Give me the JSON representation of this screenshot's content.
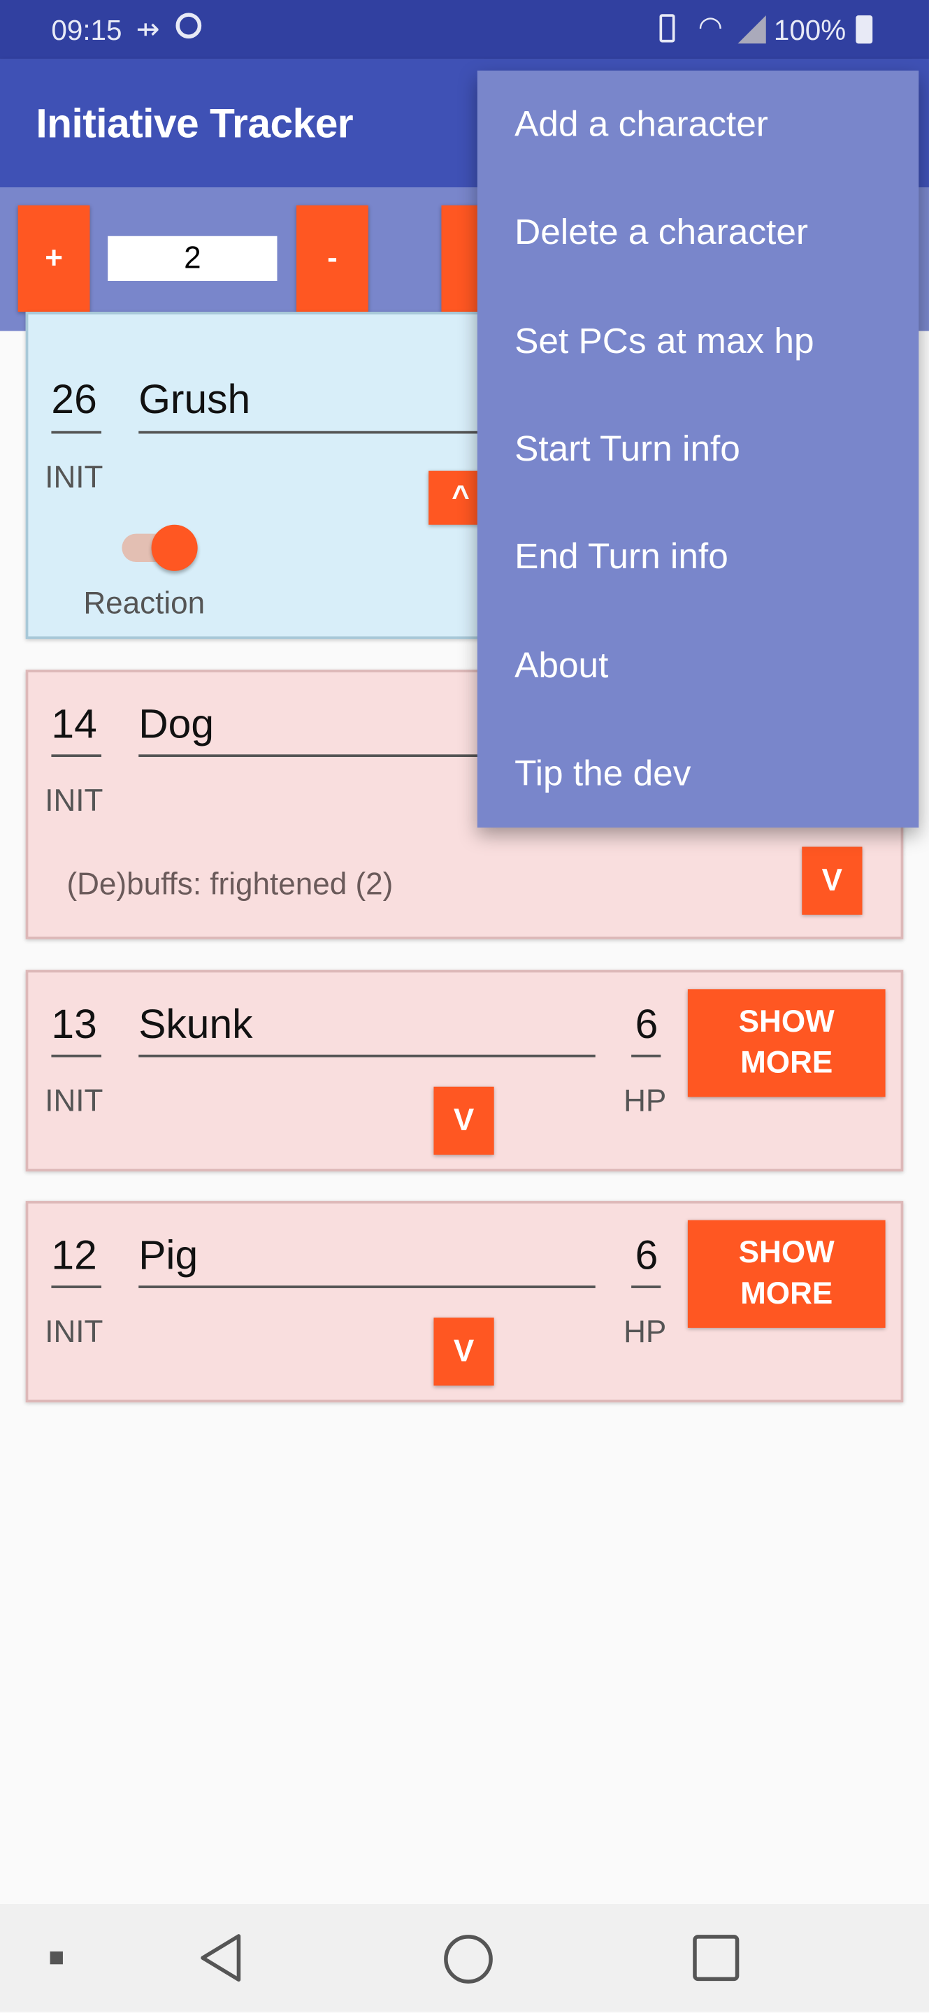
{
  "status_bar": {
    "time": "09:15",
    "battery": "100%",
    "icons": [
      "usb-icon",
      "sync-icon",
      "vibrate-icon",
      "wifi-icon",
      "signal-icon",
      "battery-charging-icon"
    ]
  },
  "app_bar": {
    "title": "Initiative Tracker"
  },
  "toolbar": {
    "plus_label": "+",
    "round_value": "2",
    "minus_label": "-"
  },
  "colors": {
    "primary": "#3F51B5",
    "primary_dark": "#3140A0",
    "accent": "#FF5722",
    "active_card": "#D8EEF9",
    "inactive_card": "#F9DEDE",
    "menu_bg": "#7986CB"
  },
  "characters": [
    {
      "init": "26",
      "name": "Grush",
      "init_label": "INIT",
      "toggle_label": "Reaction",
      "toggle_on": true,
      "expand_label": "^",
      "active": true
    },
    {
      "init": "14",
      "name": "Dog",
      "init_label": "INIT",
      "buffs": "(De)buffs: frightened (2)",
      "expand_label": "V"
    },
    {
      "init": "13",
      "name": "Skunk",
      "init_label": "INIT",
      "hp": "6",
      "hp_label": "HP",
      "show_more": "SHOW\nMORE",
      "expand_label": "V"
    },
    {
      "init": "12",
      "name": "Pig",
      "init_label": "INIT",
      "hp": "6",
      "hp_label": "HP",
      "show_more": "SHOW\nMORE",
      "expand_label": "V"
    }
  ],
  "overflow_menu": {
    "items": [
      "Add a character",
      "Delete a character",
      "Set PCs at max hp",
      "Start Turn info",
      "End Turn info",
      "About",
      "Tip the dev"
    ]
  }
}
